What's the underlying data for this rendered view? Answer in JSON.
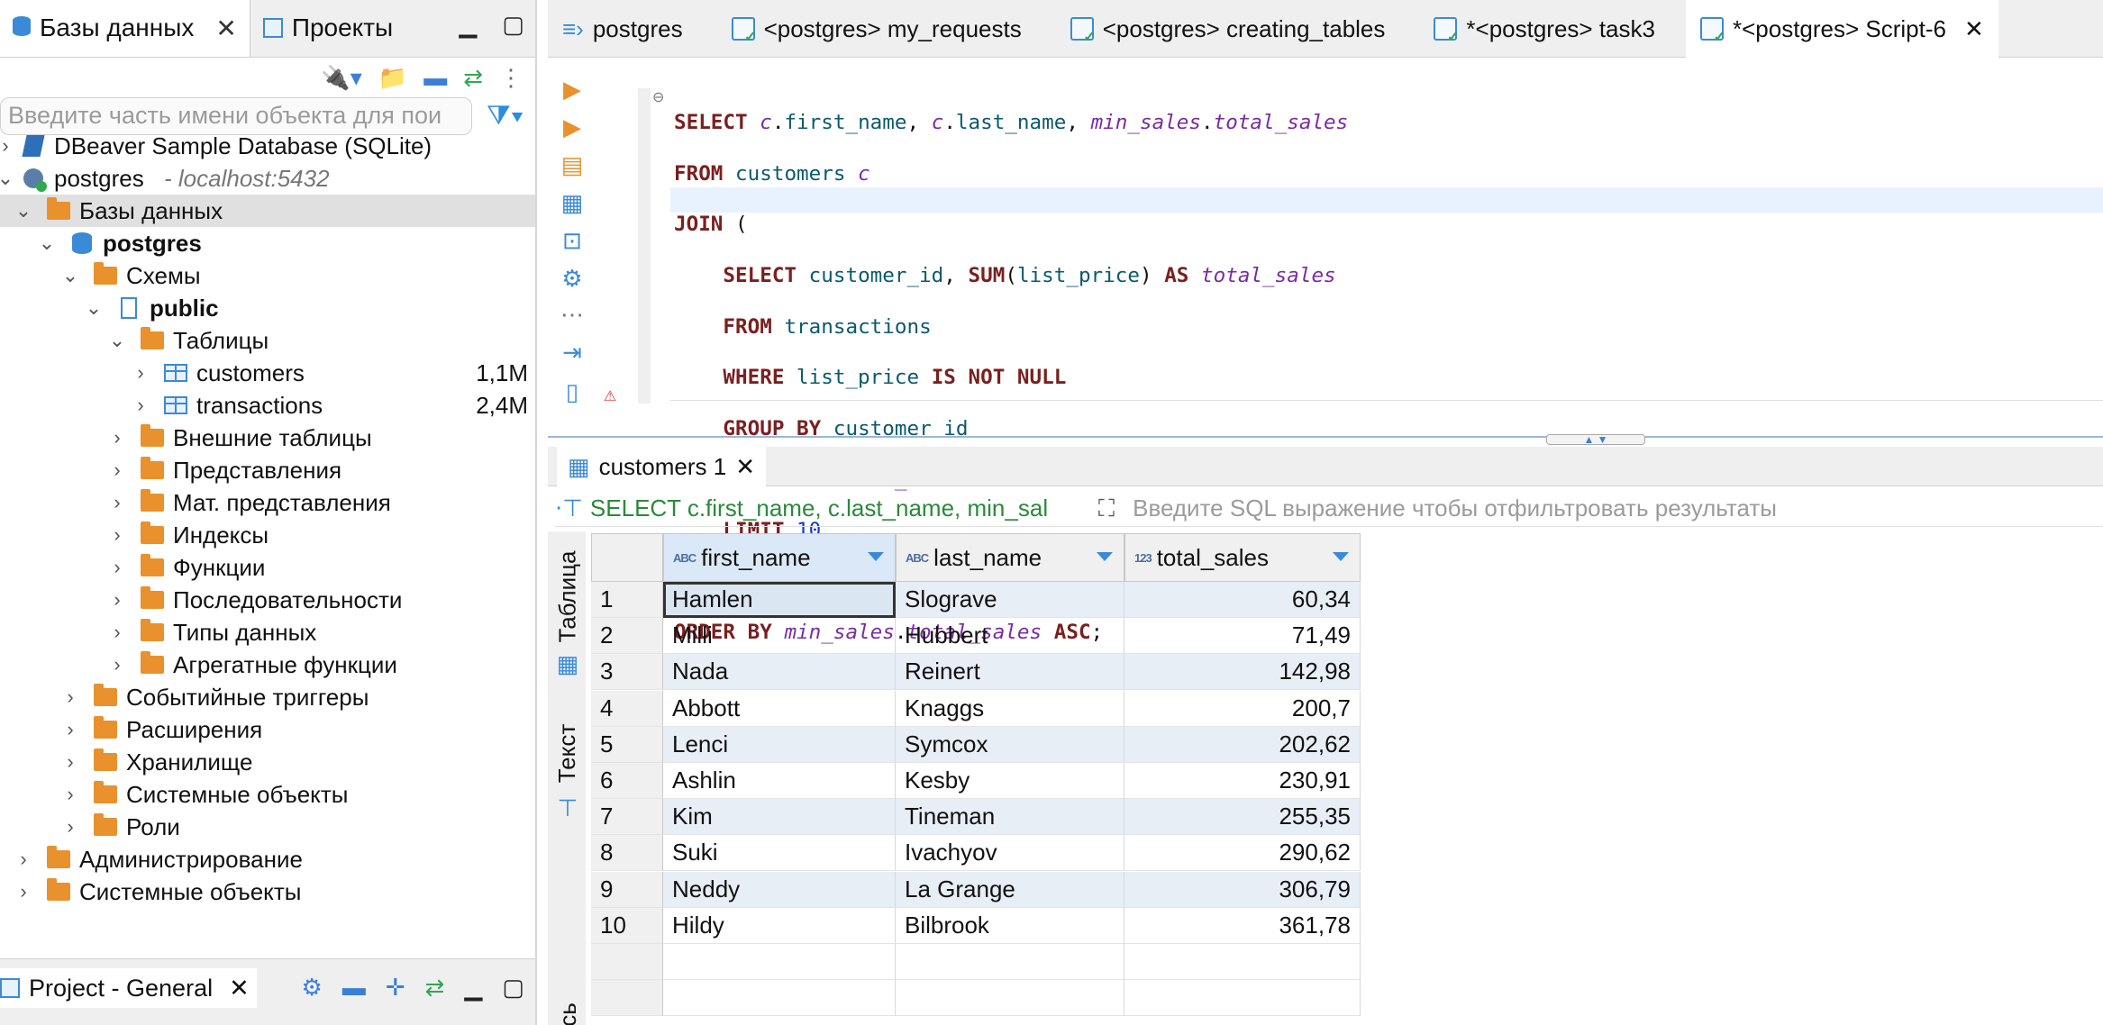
{
  "left_panel": {
    "tabs": [
      {
        "label": "Базы данных"
      },
      {
        "label": "Проекты"
      }
    ],
    "search_placeholder": "Введите часть имени объекта для пои",
    "tree": [
      {
        "label": "DBeaver Sample Database (SQLite)"
      },
      {
        "label": "postgres",
        "suffix": "- localhost:5432"
      },
      {
        "label": "Базы данных"
      },
      {
        "label": "postgres"
      },
      {
        "label": "Схемы"
      },
      {
        "label": "public"
      },
      {
        "label": "Таблицы"
      },
      {
        "label": "customers",
        "size": "1,1M"
      },
      {
        "label": "transactions",
        "size": "2,4M"
      },
      {
        "label": "Внешние таблицы"
      },
      {
        "label": "Представления"
      },
      {
        "label": "Мат. представления"
      },
      {
        "label": "Индексы"
      },
      {
        "label": "Функции"
      },
      {
        "label": "Последовательности"
      },
      {
        "label": "Типы данных"
      },
      {
        "label": "Агрегатные функции"
      },
      {
        "label": "Событийные триггеры"
      },
      {
        "label": "Расширения"
      },
      {
        "label": "Хранилище"
      },
      {
        "label": "Системные объекты"
      },
      {
        "label": "Роли"
      },
      {
        "label": "Администрирование"
      },
      {
        "label": "Системные объекты"
      }
    ],
    "bottom_tab": "Project - General"
  },
  "editor_tabs": [
    {
      "label": "postgres"
    },
    {
      "label": "<postgres> my_requests"
    },
    {
      "label": "<postgres> creating_tables"
    },
    {
      "label": "*<postgres> task3"
    },
    {
      "label": "*<postgres> Script-6"
    }
  ],
  "results": {
    "tab_label": "customers 1",
    "query_preview": "SELECT c.first_name, c.last_name, min_sal",
    "filter_placeholder": "Введите SQL выражение чтобы отфильтровать результаты",
    "vertical_tabs": {
      "table": "Таблица",
      "text": "Текст",
      "other": "сь"
    },
    "columns": [
      {
        "type_badge": "ABC",
        "name": "first_name"
      },
      {
        "type_badge": "ABC",
        "name": "last_name"
      },
      {
        "type_badge": "123",
        "name": "total_sales"
      }
    ],
    "rows": [
      {
        "n": "1",
        "first_name": "Hamlen",
        "last_name": "Slograve",
        "total_sales": "60,34"
      },
      {
        "n": "2",
        "first_name": "Milli",
        "last_name": "Hubbert",
        "total_sales": "71,49"
      },
      {
        "n": "3",
        "first_name": "Nada",
        "last_name": "Reinert",
        "total_sales": "142,98"
      },
      {
        "n": "4",
        "first_name": "Abbott",
        "last_name": "Knaggs",
        "total_sales": "200,7"
      },
      {
        "n": "5",
        "first_name": "Lenci",
        "last_name": "Symcox",
        "total_sales": "202,62"
      },
      {
        "n": "6",
        "first_name": "Ashlin",
        "last_name": "Kesby",
        "total_sales": "230,91"
      },
      {
        "n": "7",
        "first_name": "Kim",
        "last_name": "Tineman",
        "total_sales": "255,35"
      },
      {
        "n": "8",
        "first_name": "Suki",
        "last_name": "Ivachyov",
        "total_sales": "290,62"
      },
      {
        "n": "9",
        "first_name": "Neddy",
        "last_name": "La Grange",
        "total_sales": "306,79"
      },
      {
        "n": "10",
        "first_name": "Hildy",
        "last_name": "Bilbrook",
        "total_sales": "361,78"
      }
    ]
  }
}
